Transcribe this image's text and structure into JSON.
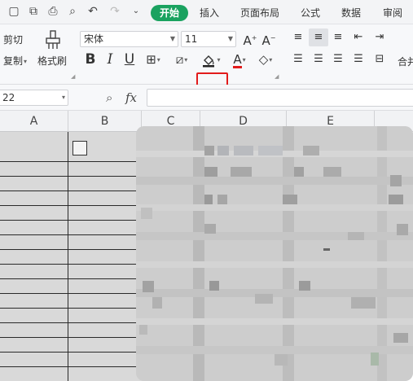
{
  "menu": {
    "tabs": [
      {
        "label": "开始",
        "active": true
      },
      {
        "label": "插入"
      },
      {
        "label": "页面布局"
      },
      {
        "label": "公式"
      },
      {
        "label": "数据"
      },
      {
        "label": "审阅"
      }
    ]
  },
  "ribbon": {
    "cut_label": "剪切",
    "copy_label": "复制",
    "format_painter_label": "格式刷",
    "font_name": "宋体",
    "font_size": "11",
    "merge_label": "合并"
  },
  "formula_bar": {
    "name_box": "22",
    "fx_label": "fx",
    "formula_value": ""
  },
  "grid": {
    "columns": [
      "A",
      "B",
      "C",
      "D",
      "E"
    ]
  },
  "colors": {
    "accent": "#1aa260",
    "highlight": "#e21b1b",
    "font_color_bar": "#e21b1b"
  }
}
